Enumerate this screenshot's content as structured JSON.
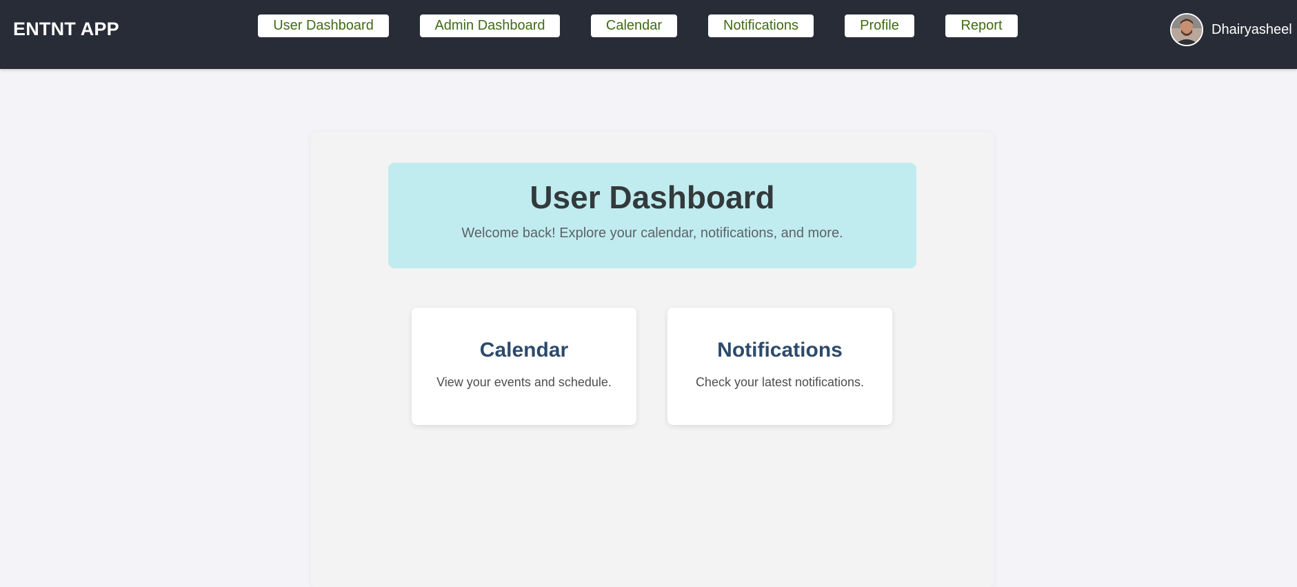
{
  "app": {
    "brand": "ENTNT APP"
  },
  "nav": {
    "items": [
      {
        "label": "User Dashboard"
      },
      {
        "label": "Admin Dashboard"
      },
      {
        "label": "Calendar"
      },
      {
        "label": "Notifications"
      },
      {
        "label": "Profile"
      },
      {
        "label": "Report"
      }
    ]
  },
  "user": {
    "name": "Dhairyasheel",
    "avatar_icon": "user-avatar-photo"
  },
  "banner": {
    "title": "User Dashboard",
    "subtitle": "Welcome back! Explore your calendar, notifications, and more."
  },
  "cards": [
    {
      "title": "Calendar",
      "description": "View your events and schedule."
    },
    {
      "title": "Notifications",
      "description": "Check your latest notifications."
    }
  ],
  "colors": {
    "navbar_bg": "#282c36",
    "nav_text": "#3f6b12",
    "banner_bg": "#c1ecef",
    "card_title": "#2c4a6b",
    "page_bg": "#f4f4f8"
  }
}
